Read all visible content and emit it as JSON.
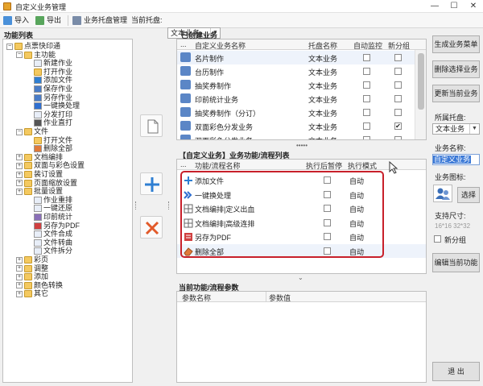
{
  "window": {
    "title": "自定义业务管理",
    "minimize": "—",
    "maximize": "☐",
    "close": "✕"
  },
  "toolbar": {
    "import_label": "导入",
    "export_label": "导出",
    "manage_label": "业务托盘管理",
    "tray_label": "当前托盘:",
    "tray_value": "文本业务"
  },
  "tree": {
    "header": "功能列表",
    "nodes": [
      {
        "label": "点票快印通",
        "level": 0,
        "exp": "−",
        "icon": "folder"
      },
      {
        "label": "主功能",
        "level": 1,
        "exp": "−",
        "icon": "folder"
      },
      {
        "label": "新建作业",
        "level": 2,
        "exp": "",
        "icon": "doc"
      },
      {
        "label": "打开作业",
        "level": 2,
        "exp": "",
        "icon": "folder"
      },
      {
        "label": "添加文件",
        "level": 2,
        "exp": "",
        "icon": "plus"
      },
      {
        "label": "保存作业",
        "level": 2,
        "exp": "",
        "icon": "save"
      },
      {
        "label": "另存作业",
        "level": 2,
        "exp": "",
        "icon": "save"
      },
      {
        "label": "一键换处理",
        "level": 2,
        "exp": "",
        "icon": "arrow"
      },
      {
        "label": "分发打印",
        "level": 2,
        "exp": "",
        "icon": "doc"
      },
      {
        "label": "作业直打",
        "level": 2,
        "exp": "",
        "icon": "print"
      },
      {
        "label": "文件",
        "level": 1,
        "exp": "−",
        "icon": "folder"
      },
      {
        "label": "打开文件",
        "level": 2,
        "exp": "",
        "icon": "folder"
      },
      {
        "label": "删除全部",
        "level": 2,
        "exp": "",
        "icon": "eraser"
      },
      {
        "label": "文档编排",
        "level": 1,
        "exp": "+",
        "icon": "folder"
      },
      {
        "label": "双面与彩色设置",
        "level": 1,
        "exp": "+",
        "icon": "folder"
      },
      {
        "label": "装订设置",
        "level": 1,
        "exp": "+",
        "icon": "folder"
      },
      {
        "label": "页面缩放设置",
        "level": 1,
        "exp": "+",
        "icon": "folder"
      },
      {
        "label": "批量设置",
        "level": 1,
        "exp": "+",
        "icon": "folder"
      },
      {
        "label": "作业重排",
        "level": 2,
        "exp": "",
        "icon": "doc"
      },
      {
        "label": "一键还原",
        "level": 2,
        "exp": "",
        "icon": "doc"
      },
      {
        "label": "印前统计",
        "level": 2,
        "exp": "",
        "icon": "chart"
      },
      {
        "label": "另存为PDF",
        "level": 2,
        "exp": "",
        "icon": "pdf"
      },
      {
        "label": "文件合成",
        "level": 2,
        "exp": "",
        "icon": "doc"
      },
      {
        "label": "文件转曲",
        "level": 2,
        "exp": "",
        "icon": "doc"
      },
      {
        "label": "文件拆分",
        "level": 2,
        "exp": "",
        "icon": "doc"
      },
      {
        "label": "彩页",
        "level": 1,
        "exp": "+",
        "icon": "folder"
      },
      {
        "label": "调整",
        "level": 1,
        "exp": "+",
        "icon": "folder"
      },
      {
        "label": "添加",
        "level": 1,
        "exp": "+",
        "icon": "folder"
      },
      {
        "label": "颜色转换",
        "level": 1,
        "exp": "+",
        "icon": "folder"
      },
      {
        "label": "其它",
        "level": 1,
        "exp": "+",
        "icon": "folder"
      }
    ]
  },
  "created": {
    "header": "已创建业务",
    "col_name": "自定义业务名称",
    "col_tray": "托盘名称",
    "col_auto": "自动监控",
    "col_new": "新分组",
    "rows": [
      {
        "name": "名片制作",
        "tray": "文本业务",
        "new": ""
      },
      {
        "name": "台历制作",
        "tray": "文本业务",
        "new": ""
      },
      {
        "name": "抽奖券制作",
        "tray": "文本业务",
        "new": ""
      },
      {
        "name": "印前统计业务",
        "tray": "文本业务",
        "new": ""
      },
      {
        "name": "抽奖券制作（分订）",
        "tray": "文本业务",
        "new": ""
      },
      {
        "name": "双面彩色分发业务",
        "tray": "文本业务",
        "new": "✔"
      },
      {
        "name": "双面彩色分发业务",
        "tray": "文本业务",
        "new": ""
      }
    ]
  },
  "flow": {
    "header": "【自定义业务】业务功能/流程列表",
    "col_func": "功能/流程名称",
    "col_pause": "执行后暂停",
    "col_mode": "执行模式",
    "rows": [
      {
        "name": "添加文件",
        "mode": "自动",
        "icon": "plus"
      },
      {
        "name": "一键换处理",
        "mode": "自动",
        "icon": "arrow"
      },
      {
        "name": "文档编排|定义出血",
        "mode": "自动",
        "icon": "grid"
      },
      {
        "name": "文档编排|高级连排",
        "mode": "自动",
        "icon": "grid"
      },
      {
        "name": "另存为PDF",
        "mode": "自动",
        "icon": "pdf"
      },
      {
        "name": "删除全部",
        "mode": "自动",
        "icon": "eraser"
      }
    ]
  },
  "params": {
    "header": "当前功能/流程参数",
    "col_name": "参数名称",
    "col_value": "参数值"
  },
  "right": {
    "gen_menu": "生成业务菜单",
    "delete_selected": "删除选择业务",
    "update_current": "更新当前业务",
    "tray_label": "所属托盘:",
    "tray_value": "文本业务",
    "name_label": "业务名称:",
    "name_value": "自定义业务",
    "icon_label": "业务图标:",
    "select_btn": "选择",
    "size_label": "支持尺寸:",
    "size_value": "16*16  32*32",
    "new_group": "新分组",
    "edit_btn": "编辑当前功能",
    "exit_btn": "退 出"
  },
  "colors": {
    "highlight_box": "#c8202a",
    "selected_name": "#3a78d6",
    "row_alt": "#eef3fb"
  }
}
